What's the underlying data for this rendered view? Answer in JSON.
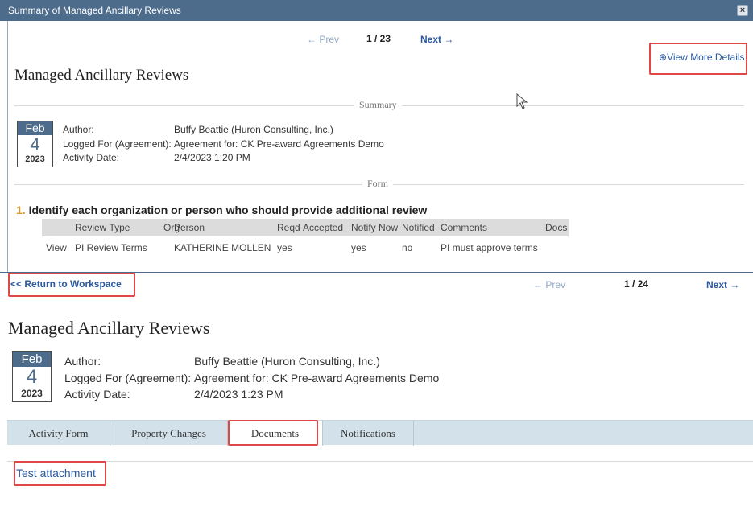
{
  "dialog": {
    "title": "Summary of Managed Ancillary Reviews",
    "close_label": "×",
    "nav": {
      "prev": "← Prev",
      "counter": "1 / 23",
      "next": "Next →"
    },
    "view_more": "View More Details",
    "heading": "Managed Ancillary Reviews",
    "summary_label": "Summary",
    "date": {
      "month": "Feb",
      "day": "4",
      "year": "2023"
    },
    "meta": {
      "author_label": "Author:",
      "author_value": "Buffy Beattie (Huron Consulting, Inc.)",
      "logged_label": "Logged For (Agreement):",
      "logged_value": "Agreement for: CK Pre-award Agreements Demo",
      "activity_label": "Activity Date:",
      "activity_value": "2/4/2023 1:20 PM"
    },
    "form_label": "Form",
    "question": {
      "number": "1.",
      "text": "Identify each organization or person who should provide additional review"
    },
    "table": {
      "headers": [
        "Review Type",
        "Org",
        "Person",
        "Reqd",
        "Accepted",
        "Notify Now",
        "Notified",
        "Comments",
        "Docs"
      ],
      "row": {
        "view": "View",
        "review_type": "PI Review Terms",
        "person": "KATHERINE MOLLEN",
        "reqd": "yes",
        "notify_now": "yes",
        "notified": "no",
        "comments": "PI must approve terms"
      }
    }
  },
  "page": {
    "return_link": "<< Return to Workspace",
    "nav": {
      "prev": "← Prev",
      "counter": "1 / 24",
      "next": "Next →"
    },
    "heading": "Managed Ancillary Reviews",
    "date": {
      "month": "Feb",
      "day": "4",
      "year": "2023"
    },
    "meta": {
      "author_label": "Author:",
      "author_value": "Buffy Beattie (Huron Consulting, Inc.)",
      "logged_label": "Logged For (Agreement):",
      "logged_value": "Agreement for: CK Pre-award Agreements Demo",
      "activity_label": "Activity Date:",
      "activity_value": "2/4/2023 1:23 PM"
    },
    "tabs": [
      "Activity Form",
      "Property Changes",
      "Documents",
      "Notifications"
    ],
    "attachment": "Test attachment"
  },
  "colors": {
    "titlebar": "#4d6b8a",
    "link": "#2a5aa0",
    "highlight": "#e04848",
    "tabbar": "#d3e1ea",
    "question_number": "#d89a2b"
  }
}
